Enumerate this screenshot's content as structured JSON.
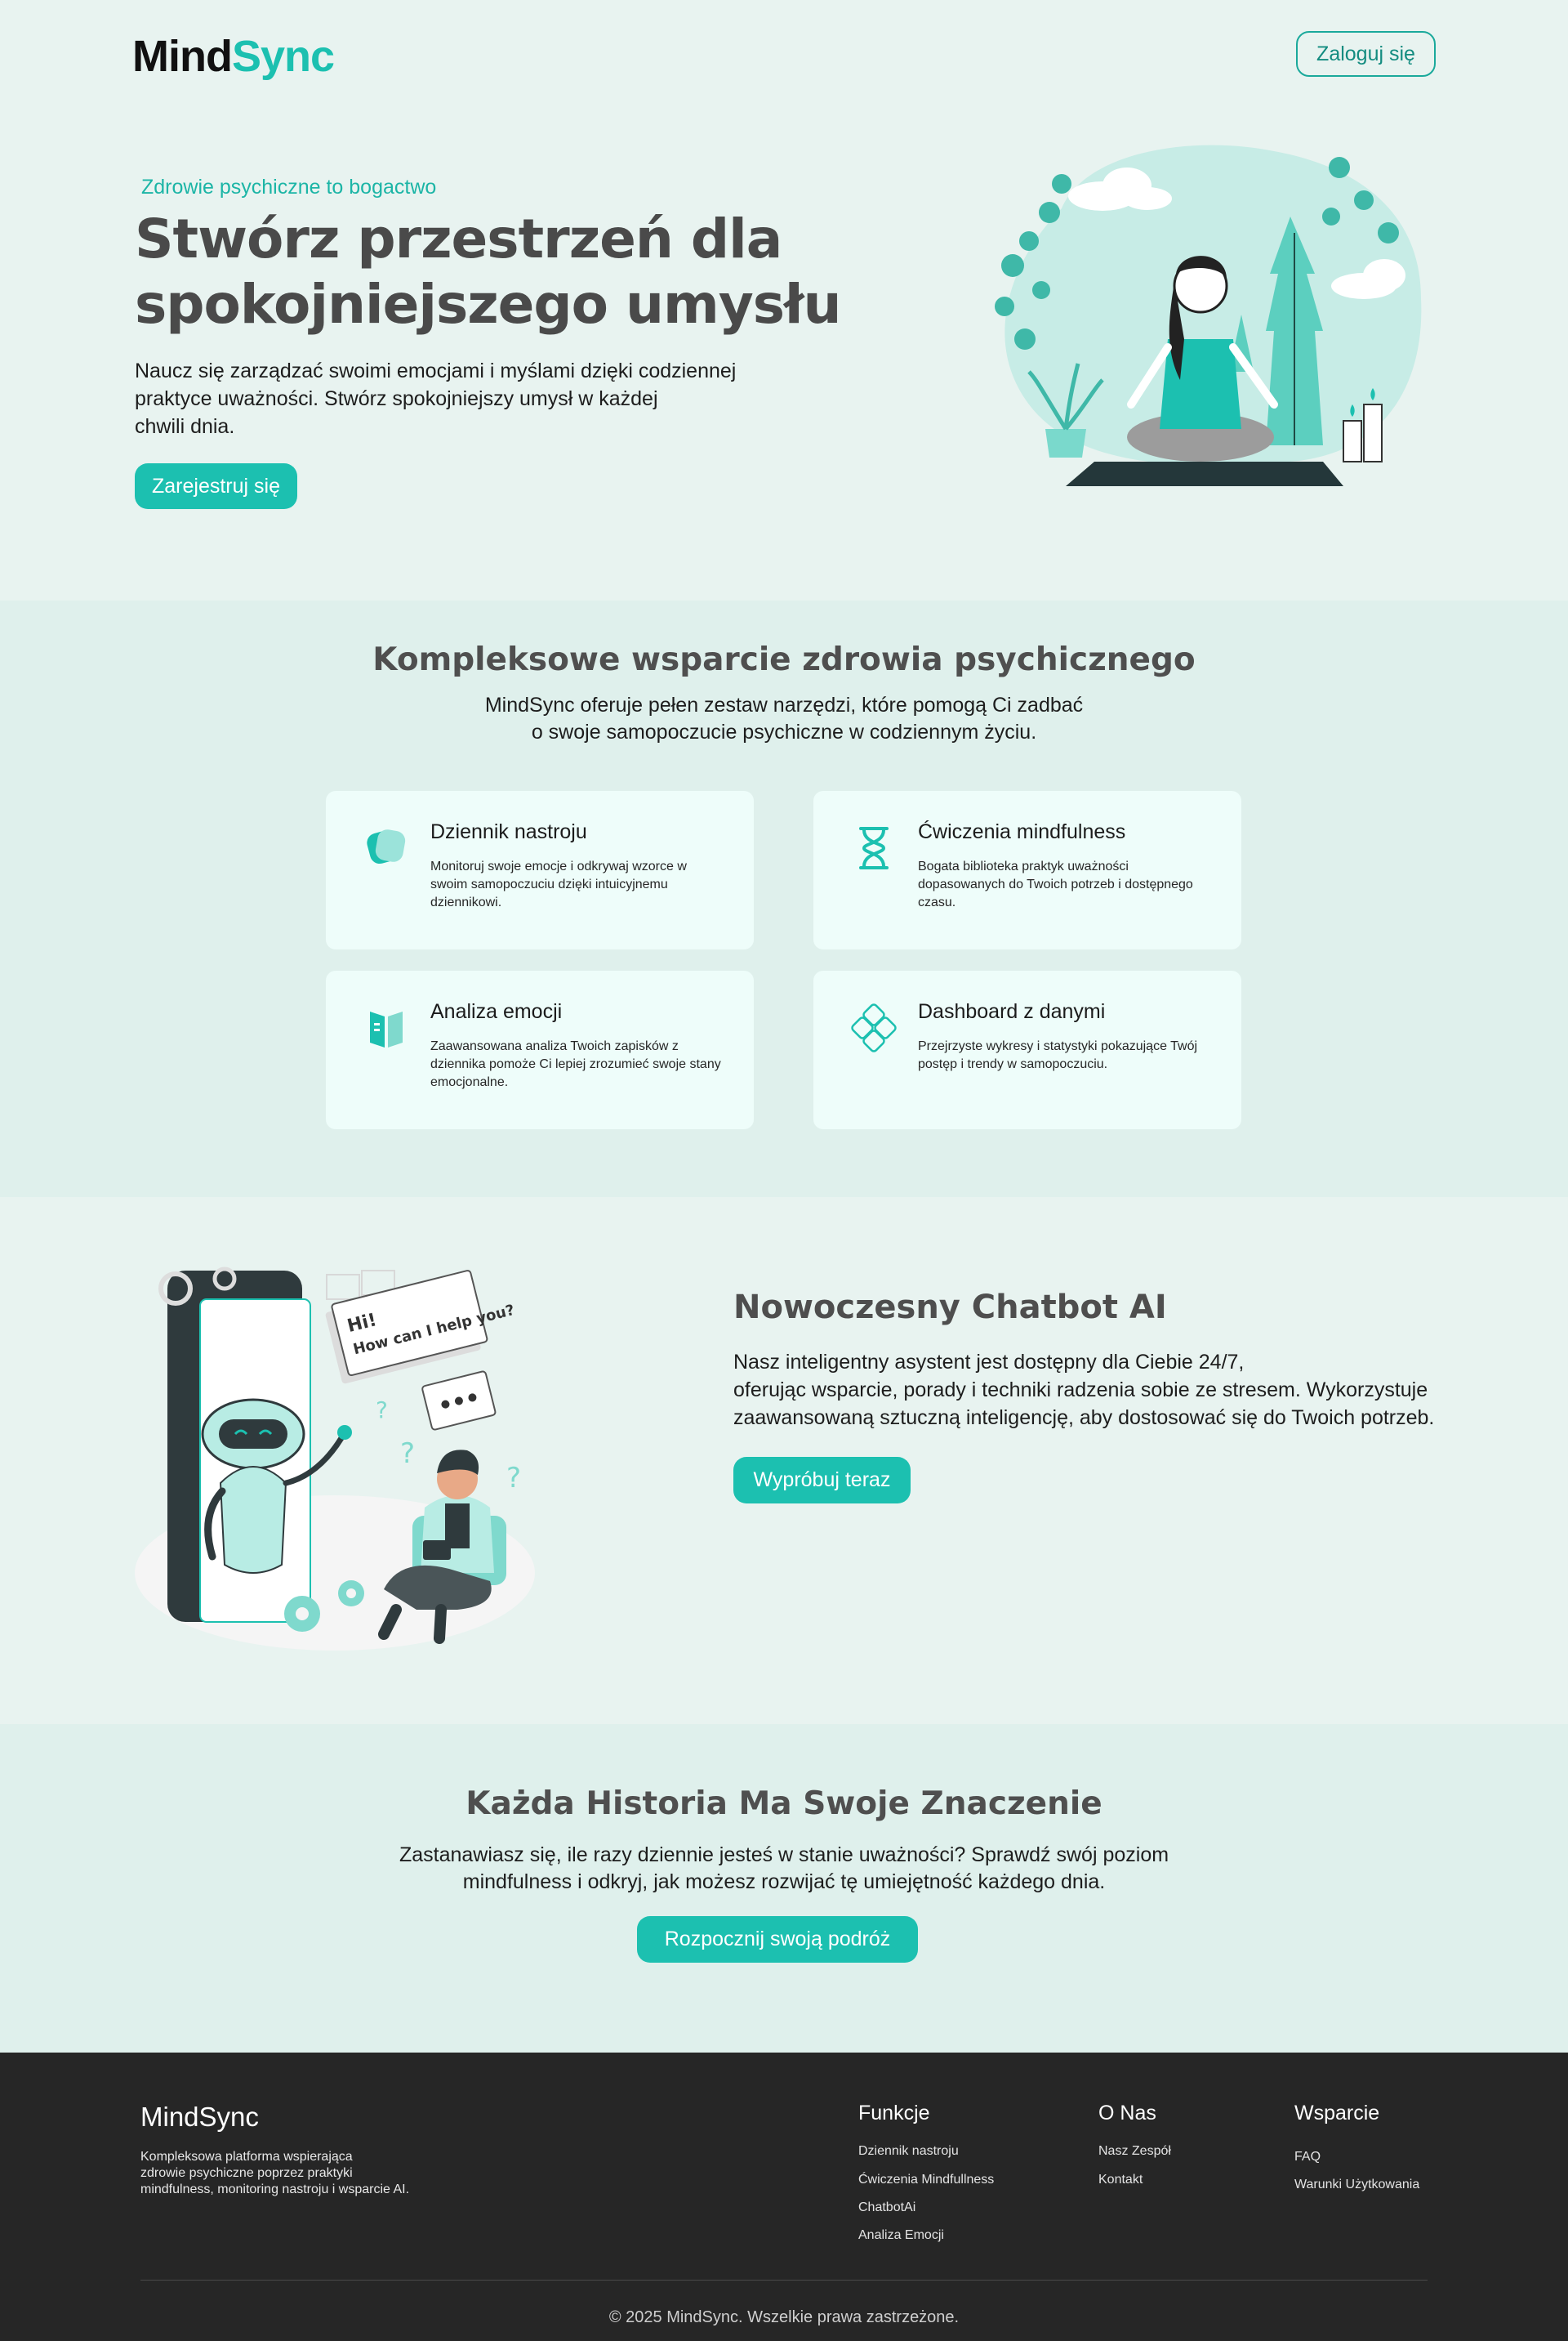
{
  "header": {
    "logo_part1": "Mind",
    "logo_part2": "Sync",
    "login_label": "Zaloguj się"
  },
  "hero": {
    "tagline": "Zdrowie psychiczne to bogactwo",
    "title_line1": "Stwórz przestrzeń dla",
    "title_line2": "spokojniejszego umysłu",
    "desc_line1": "Naucz się zarządzać swoimi emocjami i myślami dzięki codziennej",
    "desc_line2": "praktyce uważności. Stwórz spokojniejszy umysł w każdej",
    "desc_line3": "chwili dnia.",
    "cta_label": "Zarejestruj się"
  },
  "features": {
    "title": "Kompleksowe wsparcie zdrowia psychicznego",
    "subtitle_line1": "MindSync oferuje pełen zestaw narzędzi, które pomogą Ci zadbać",
    "subtitle_line2": "o swoje samopoczucie psychiczne w codziennym życiu.",
    "cards": [
      {
        "icon": "mood-journal-icon",
        "title": "Dziennik nastroju",
        "desc": "Monitoruj swoje emocje i odkrywaj wzorce w swoim samopoczuciu dzięki intuicyjnemu dziennikowi."
      },
      {
        "icon": "hourglass-icon",
        "title": "Ćwiczenia mindfulness",
        "desc": "Bogata biblioteka praktyk uważności dopasowanych do Twoich potrzeb i dostępnego czasu."
      },
      {
        "icon": "book-icon",
        "title": "Analiza emocji",
        "desc": "Zaawansowana analiza Twoich zapisków z dziennika pomoże Ci lepiej zrozumieć swoje stany emocjonalne."
      },
      {
        "icon": "dashboard-diamond-icon",
        "title": "Dashboard z danymi",
        "desc": "Przejrzyste wykresy i statystyki pokazujące Twój postęp i trendy w samopoczuciu."
      }
    ]
  },
  "chatbot": {
    "title": "Nowoczesny Chatbot AI",
    "desc_line1": "Nasz inteligentny asystent jest dostępny dla Ciebie 24/7,",
    "desc_line2": "oferując wsparcie, porady i techniki radzenia sobie ze stresem. Wykorzystuje",
    "desc_line3": "zaawansowaną sztuczną inteligencję, aby dostosować się do Twoich potrzeb.",
    "cta_label": "Wypróbuj teraz",
    "bubble_text1": "Hi!",
    "bubble_text2": "How can I help you?"
  },
  "story": {
    "title": "Każda Historia Ma Swoje Znaczenie",
    "subtitle_line1": "Zastanawiasz się, ile razy dziennie jesteś w stanie uważności? Sprawdź swój poziom",
    "subtitle_line2": "mindfulness i odkryj, jak możesz rozwijać tę umiejętność każdego dnia.",
    "cta_label": "Rozpocznij swoją podróż"
  },
  "footer": {
    "brand": "MindSync",
    "desc_line1": "Kompleksowa platforma wspierająca",
    "desc_line2": "zdrowie psychiczne poprzez praktyki",
    "desc_line3": "mindfulness, monitoring nastroju i wsparcie AI.",
    "columns": [
      {
        "title": "Funkcje",
        "links": [
          "Dziennik nastroju",
          "Ćwiczenia Mindfullness",
          "ChatbotAi",
          "Analiza Emocji"
        ]
      },
      {
        "title": "O Nas",
        "links": [
          "Nasz Zespół",
          "Kontakt"
        ]
      },
      {
        "title": "Wsparcie",
        "links": [
          "FAQ",
          "Warunki Użytkowania"
        ]
      }
    ],
    "copyright": "© 2025 MindSync. Wszelkie prawa zastrzeżone."
  },
  "colors": {
    "accent": "#1cc0b0",
    "page_bg": "#e8f3f0",
    "section_bg": "#dff0ec",
    "card_bg": "#eefdfa",
    "footer_bg": "#262626"
  }
}
